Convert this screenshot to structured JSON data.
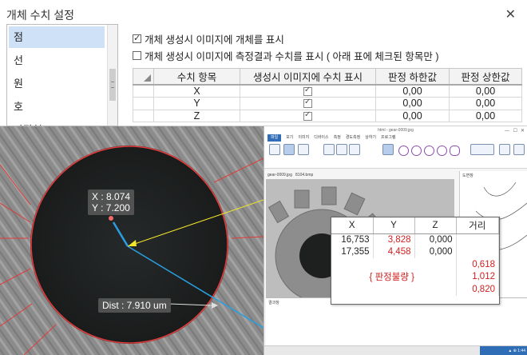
{
  "dialog": {
    "title": "개체 수치 설정",
    "close": "✕",
    "list_items": [
      "점",
      "선",
      "원",
      "호",
      "다각형"
    ],
    "selected_index": 0,
    "options": [
      {
        "label": "개체 생성시 이미지에 개체를 표시",
        "checked": true
      },
      {
        "label": "개체 생성시 이미지에 측정결과 수치를 표시 ( 아래 표에 체크된 항목만 )",
        "checked": false
      }
    ],
    "table": {
      "headers": [
        "수치 항목",
        "생성시 이미지에 수치 표시",
        "판정 하한값",
        "판정 상한값"
      ],
      "rows": [
        {
          "item": "X",
          "show": true,
          "lower": "0,00",
          "upper": "0,00"
        },
        {
          "item": "Y",
          "show": true,
          "lower": "0,00",
          "upper": "0,00"
        },
        {
          "item": "Z",
          "show": true,
          "lower": "0,00",
          "upper": "0,00"
        }
      ]
    }
  },
  "scope": {
    "coord_x": "X : 8.074",
    "coord_y": "Y : 7.200",
    "dist": "Dist : 7.910 um"
  },
  "app": {
    "title": "html - gear-0009.jpg",
    "tabs": [
      "파일",
      "보기",
      "이미지",
      "디바이스",
      "측정",
      "경도측정",
      "상하기",
      "프로그램"
    ],
    "image_tab": "gear-0009.jpg",
    "image_tab2": "8104.bmp",
    "side_header": "도면창",
    "result_header": "결과창",
    "status_right": "▲ ⊕ 1:44"
  },
  "popup": {
    "headers": [
      "X",
      "Y",
      "Z",
      "거리"
    ],
    "rows": [
      [
        "16,753",
        "3,828",
        "0,000",
        ""
      ],
      [
        "17,355",
        "4,458",
        "0,000",
        ""
      ]
    ],
    "fail_label": "{ 판정불량 }",
    "distances": [
      "0,618",
      "1,012",
      "0,820"
    ]
  }
}
